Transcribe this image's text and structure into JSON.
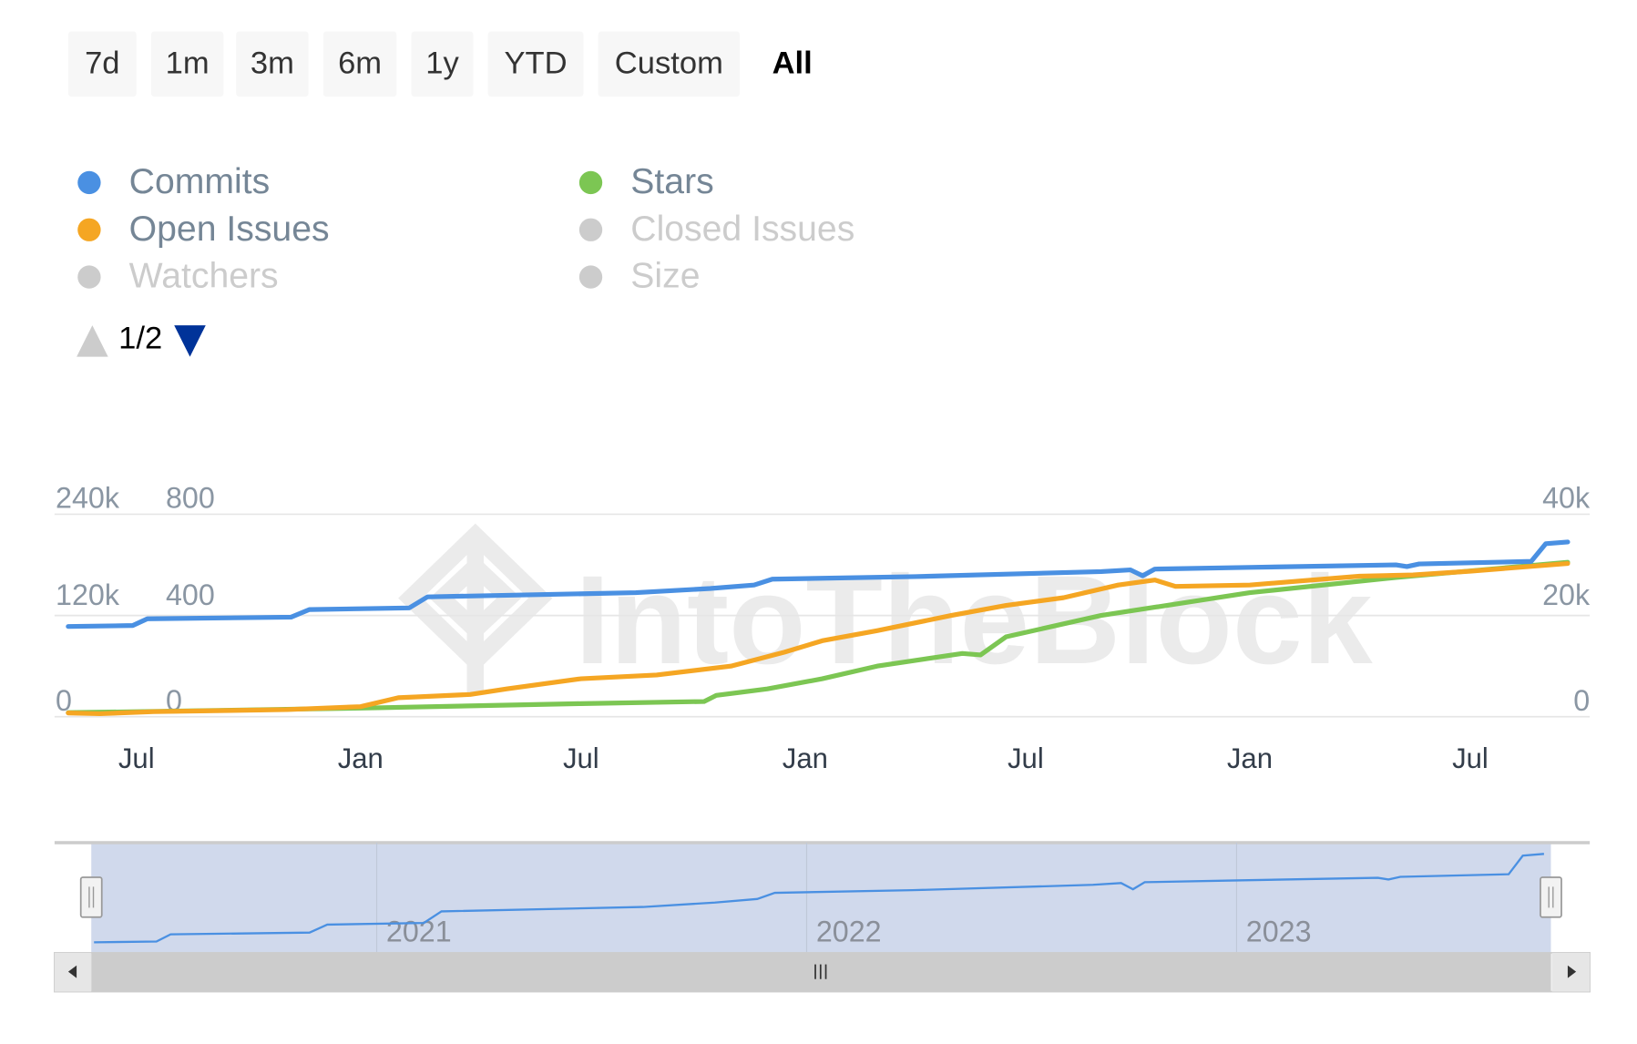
{
  "range_selector": {
    "buttons": [
      "7d",
      "1m",
      "3m",
      "6m",
      "1y",
      "YTD",
      "Custom",
      "All"
    ],
    "selected": "All"
  },
  "legend": {
    "items": [
      {
        "name": "Commits",
        "color": "#4a90e2",
        "visible": true
      },
      {
        "name": "Open Issues",
        "color": "#f5a623",
        "visible": true
      },
      {
        "name": "Watchers",
        "color": "#cccccc",
        "visible": false
      },
      {
        "name": "Stars",
        "color": "#7cc653",
        "visible": true
      },
      {
        "name": "Closed Issues",
        "color": "#cccccc",
        "visible": false
      },
      {
        "name": "Size",
        "color": "#cccccc",
        "visible": false
      }
    ],
    "pager": {
      "text": "1/2",
      "up_icon": "triangle-up-icon",
      "down_icon": "triangle-down-icon",
      "up_color": "#cccccc",
      "down_color": "#003399"
    }
  },
  "watermark": "IntoTheBlock",
  "chart_data": {
    "type": "line",
    "grid": true,
    "x_range": [
      "2020-05-06",
      "2023-09-19"
    ],
    "x_ticks": [
      {
        "date": "2020-07-01",
        "label": "Jul"
      },
      {
        "date": "2021-01-01",
        "label": "Jan"
      },
      {
        "date": "2021-07-01",
        "label": "Jul"
      },
      {
        "date": "2022-01-01",
        "label": "Jan"
      },
      {
        "date": "2022-07-01",
        "label": "Jul"
      },
      {
        "date": "2023-01-01",
        "label": "Jan"
      },
      {
        "date": "2023-07-01",
        "label": "Jul"
      }
    ],
    "y_axes": [
      {
        "id": "commits",
        "side": "left",
        "range": [
          0,
          240000
        ],
        "ticks": [
          "0",
          "120k",
          "240k"
        ]
      },
      {
        "id": "issues",
        "side": "left",
        "range": [
          0,
          800
        ],
        "ticks": [
          "0",
          "400",
          "800"
        ]
      },
      {
        "id": "stars",
        "side": "right",
        "range": [
          0,
          40000
        ],
        "ticks": [
          "0",
          "20k",
          "40k"
        ]
      }
    ],
    "series": [
      {
        "name": "Commits",
        "axis": "commits",
        "color": "#4a90e2",
        "points": [
          [
            "2020-05-06",
            107000
          ],
          [
            "2020-06-28",
            108000
          ],
          [
            "2020-07-10",
            116000
          ],
          [
            "2020-11-05",
            118000
          ],
          [
            "2020-11-20",
            127000
          ],
          [
            "2021-02-10",
            129000
          ],
          [
            "2021-02-25",
            142000
          ],
          [
            "2021-08-15",
            147000
          ],
          [
            "2021-10-15",
            152000
          ],
          [
            "2021-11-20",
            156000
          ],
          [
            "2021-12-05",
            163000
          ],
          [
            "2022-04-01",
            166000
          ],
          [
            "2022-09-01",
            172000
          ],
          [
            "2022-09-25",
            174000
          ],
          [
            "2022-10-05",
            167000
          ],
          [
            "2022-10-15",
            175000
          ],
          [
            "2023-01-01",
            177000
          ],
          [
            "2023-05-01",
            180000
          ],
          [
            "2023-05-10",
            178000
          ],
          [
            "2023-05-20",
            181000
          ],
          [
            "2023-08-20",
            184000
          ],
          [
            "2023-09-01",
            205000
          ],
          [
            "2023-09-19",
            207000
          ]
        ]
      },
      {
        "name": "Open Issues",
        "axis": "issues",
        "color": "#f5a623",
        "points": [
          [
            "2020-05-06",
            15
          ],
          [
            "2020-06-01",
            12
          ],
          [
            "2020-07-15",
            20
          ],
          [
            "2020-11-01",
            28
          ],
          [
            "2021-01-01",
            40
          ],
          [
            "2021-02-01",
            75
          ],
          [
            "2021-04-01",
            88
          ],
          [
            "2021-05-01",
            110
          ],
          [
            "2021-07-01",
            150
          ],
          [
            "2021-09-01",
            165
          ],
          [
            "2021-11-01",
            200
          ],
          [
            "2021-12-15",
            255
          ],
          [
            "2022-01-15",
            300
          ],
          [
            "2022-03-01",
            340
          ],
          [
            "2022-05-01",
            400
          ],
          [
            "2022-06-15",
            440
          ],
          [
            "2022-08-01",
            470
          ],
          [
            "2022-09-15",
            520
          ],
          [
            "2022-10-15",
            540
          ],
          [
            "2022-11-01",
            515
          ],
          [
            "2023-01-01",
            520
          ],
          [
            "2023-04-01",
            555
          ],
          [
            "2023-05-15",
            560
          ],
          [
            "2023-07-01",
            575
          ],
          [
            "2023-09-19",
            605
          ]
        ]
      },
      {
        "name": "Stars",
        "axis": "stars",
        "color": "#7cc653",
        "points": [
          [
            "2020-05-06",
            800
          ],
          [
            "2020-07-01",
            1000
          ],
          [
            "2021-01-01",
            1700
          ],
          [
            "2021-07-01",
            2600
          ],
          [
            "2021-10-10",
            3000
          ],
          [
            "2021-10-20",
            4200
          ],
          [
            "2021-12-01",
            5500
          ],
          [
            "2022-01-15",
            7500
          ],
          [
            "2022-03-01",
            10000
          ],
          [
            "2022-05-10",
            12500
          ],
          [
            "2022-05-25",
            12200
          ],
          [
            "2022-06-15",
            15800
          ],
          [
            "2022-09-01",
            20000
          ],
          [
            "2023-01-01",
            24500
          ],
          [
            "2023-05-01",
            27500
          ],
          [
            "2023-09-19",
            30500
          ]
        ]
      }
    ],
    "navigator": {
      "series": "Commits",
      "x_ticks": [
        {
          "date": "2021-01-01",
          "label": "2021"
        },
        {
          "date": "2022-01-01",
          "label": "2022"
        },
        {
          "date": "2023-01-01",
          "label": "2023"
        }
      ],
      "selection": [
        "2020-05-06",
        "2023-09-19"
      ]
    }
  }
}
